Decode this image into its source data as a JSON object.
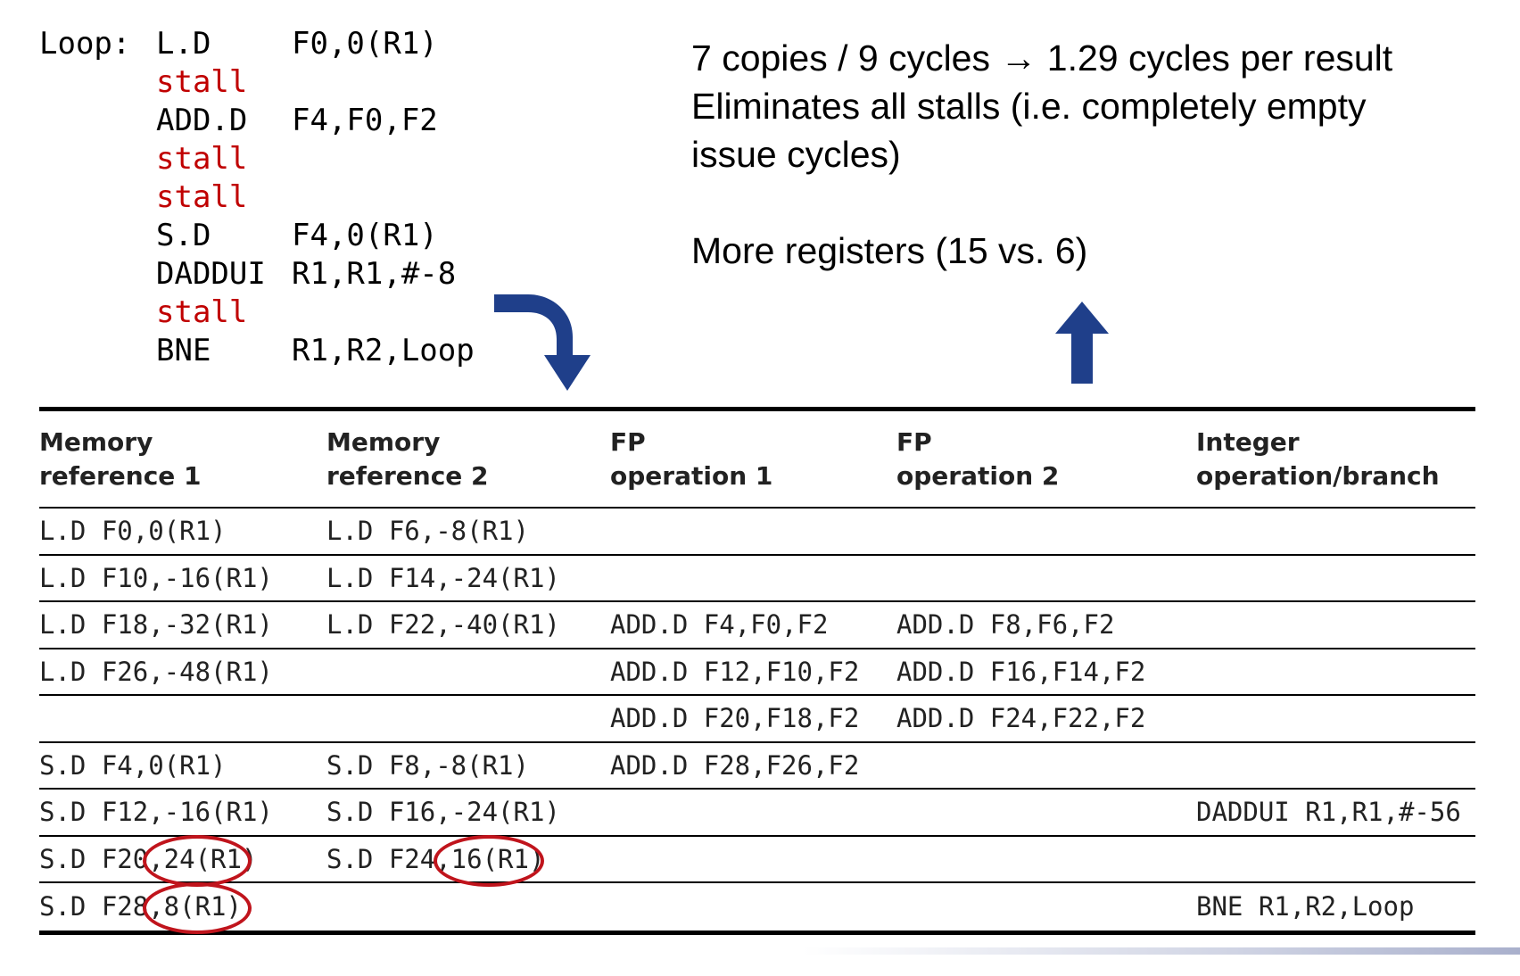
{
  "code": {
    "lines": [
      {
        "label": "Loop:",
        "op": "L.D",
        "args": "F0,0(R1)",
        "stall": false
      },
      {
        "label": "",
        "op": "stall",
        "args": "",
        "stall": true
      },
      {
        "label": "",
        "op": "ADD.D",
        "args": "F4,F0,F2",
        "stall": false
      },
      {
        "label": "",
        "op": "stall",
        "args": "",
        "stall": true
      },
      {
        "label": "",
        "op": "stall",
        "args": "",
        "stall": true
      },
      {
        "label": "",
        "op": "S.D",
        "args": "F4,0(R1)",
        "stall": false
      },
      {
        "label": "",
        "op": "DADDUI",
        "args": "R1,R1,#-8",
        "stall": false
      },
      {
        "label": "",
        "op": "stall",
        "args": "",
        "stall": true
      },
      {
        "label": "",
        "op": "BNE",
        "args": "R1,R2,Loop",
        "stall": false
      }
    ]
  },
  "notes": {
    "line1": "7 copies / 9 cycles → 1.29 cycles per result",
    "line2": "Eliminates all stalls (i.e. completely empty",
    "line3": "issue cycles)",
    "line4": "More registers (15 vs. 6)"
  },
  "table": {
    "headers": [
      [
        "Memory",
        "reference 1"
      ],
      [
        "Memory",
        "reference 2"
      ],
      [
        "FP",
        "operation 1"
      ],
      [
        "FP",
        "operation 2"
      ],
      [
        "Integer",
        "operation/branch"
      ]
    ],
    "rows": [
      [
        "L.D F0,0(R1)",
        "L.D F6,-8(R1)",
        "",
        "",
        ""
      ],
      [
        "L.D F10,-16(R1)",
        "L.D F14,-24(R1)",
        "",
        "",
        ""
      ],
      [
        "L.D F18,-32(R1)",
        "L.D F22,-40(R1)",
        "ADD.D F4,F0,F2",
        "ADD.D F8,F6,F2",
        ""
      ],
      [
        "L.D F26,-48(R1)",
        "",
        "ADD.D F12,F10,F2",
        "ADD.D F16,F14,F2",
        ""
      ],
      [
        "",
        "",
        "ADD.D F20,F18,F2",
        "ADD.D F24,F22,F2",
        ""
      ],
      [
        "S.D F4,0(R1)",
        "S.D F8,-8(R1)",
        "ADD.D F28,F26,F2",
        "",
        ""
      ],
      [
        "S.D F12,-16(R1)",
        "S.D F16,-24(R1)",
        "",
        "",
        "DADDUI R1,R1,#-56"
      ],
      [
        "S.D F20,24(R1)",
        "S.D F24,16(R1)",
        "",
        "",
        ""
      ],
      [
        "S.D F28,8(R1)",
        "",
        "",
        "",
        "BNE R1,R2,Loop"
      ]
    ]
  },
  "colors": {
    "stall": "#c00000",
    "arrow": "#1f3f8a",
    "circle": "#c0141c"
  },
  "icons": {
    "curved_arrow": "curved-down-arrow-icon",
    "up_arrow": "up-arrow-icon"
  }
}
